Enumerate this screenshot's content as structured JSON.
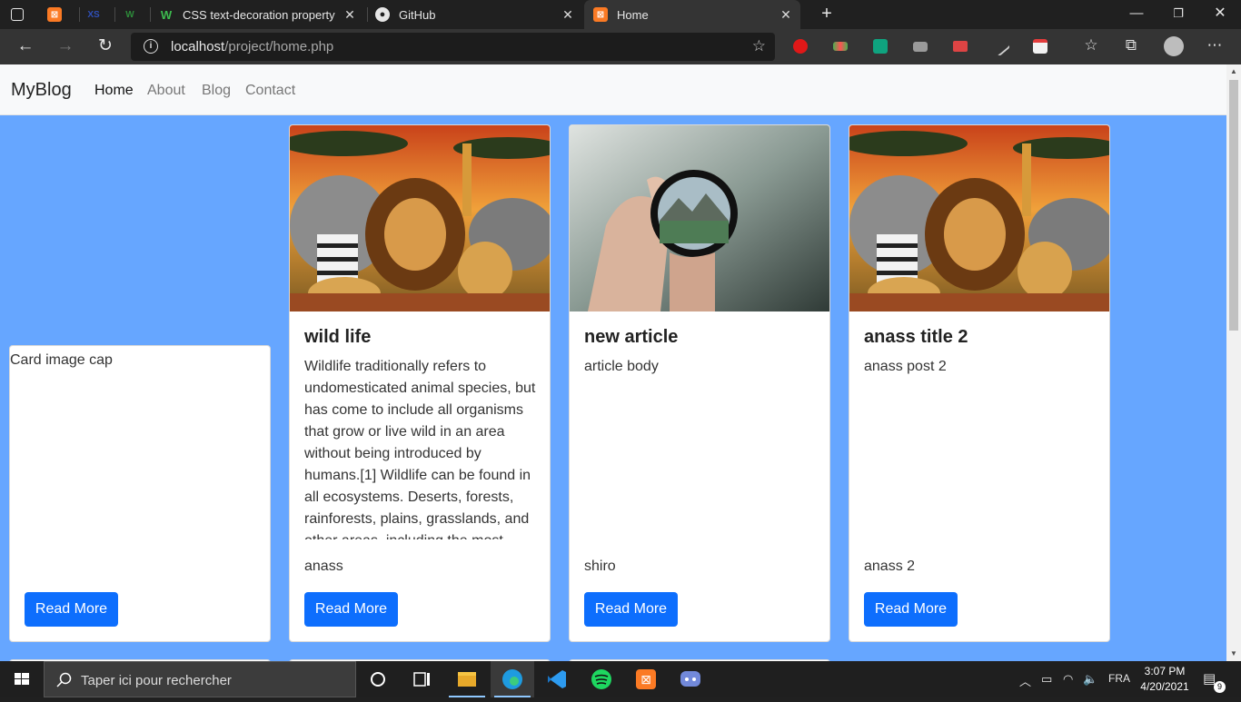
{
  "browser": {
    "tabs": [
      {
        "label": "",
        "icon": "xampp-icon"
      },
      {
        "label": "",
        "icon": "xs-icon"
      },
      {
        "label": "",
        "icon": "w3schools-icon"
      },
      {
        "label": "CSS text-decoration property",
        "icon": "w3schools-icon"
      },
      {
        "label": "GitHub",
        "icon": "github-icon"
      },
      {
        "label": "Home",
        "icon": "xampp-icon"
      }
    ],
    "url_host": "localhost",
    "url_path": "/project/home.php"
  },
  "site": {
    "brand": "MyBlog",
    "nav": [
      "Home",
      "About",
      "Blog",
      "Contact"
    ],
    "active_nav": "Home",
    "background": "#66a6ff"
  },
  "cards": [
    {
      "image_alt": "Card image cap",
      "title": "",
      "body": "",
      "author": "",
      "button": "Read More"
    },
    {
      "title": "wild life",
      "body": "Wildlife traditionally refers to undomesticated animal species, but has come to include all organisms that grow or live wild in an area without being introduced by humans.[1] Wildlife can be found in all ecosystems. Deserts, forests, rainforests, plains, grasslands, and other areas, including the most",
      "author": "anass",
      "button": "Read More"
    },
    {
      "title": "new article",
      "body": "article body",
      "author": "shiro",
      "button": "Read More"
    },
    {
      "title": "anass title 2",
      "body": "anass post 2",
      "author": "anass 2",
      "button": "Read More"
    }
  ],
  "taskbar": {
    "search_placeholder": "Taper ici pour rechercher",
    "language": "FRA",
    "time": "3:07 PM",
    "date": "4/20/2021",
    "notifications": "9"
  }
}
